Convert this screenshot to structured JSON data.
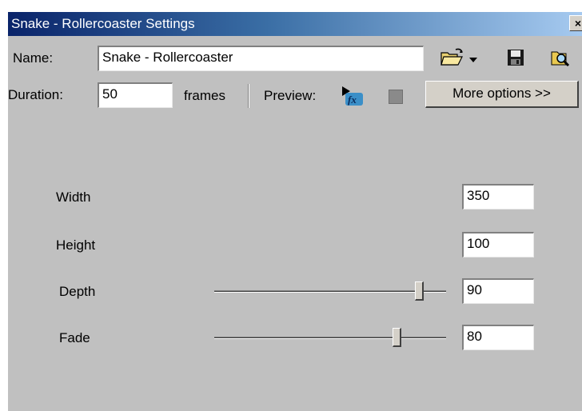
{
  "window": {
    "title": "Snake - Rollercoaster Settings",
    "close_glyph": "×"
  },
  "toolbar": {
    "name_label": "Name:",
    "name_value": "Snake - Rollercoaster",
    "duration_label": "Duration:",
    "duration_value": "50",
    "duration_unit": "frames",
    "preview_label": "Preview:",
    "more_options_label": "More options >>",
    "icons": [
      "open-folder-icon",
      "dropdown-arrow-icon",
      "save-icon",
      "browse-icon",
      "preview-fx-icon",
      "stop-icon"
    ]
  },
  "params": [
    {
      "label": "Width",
      "value": "350"
    },
    {
      "label": "Height",
      "value": "100"
    },
    {
      "label": "Depth",
      "value": "90",
      "slider_fraction": 0.9
    },
    {
      "label": "Fade",
      "value": "80",
      "slider_fraction": 0.8
    }
  ],
  "colors": {
    "face": "#c0c0c0",
    "title_start": "#0a246a",
    "title_end": "#a6caf0"
  }
}
